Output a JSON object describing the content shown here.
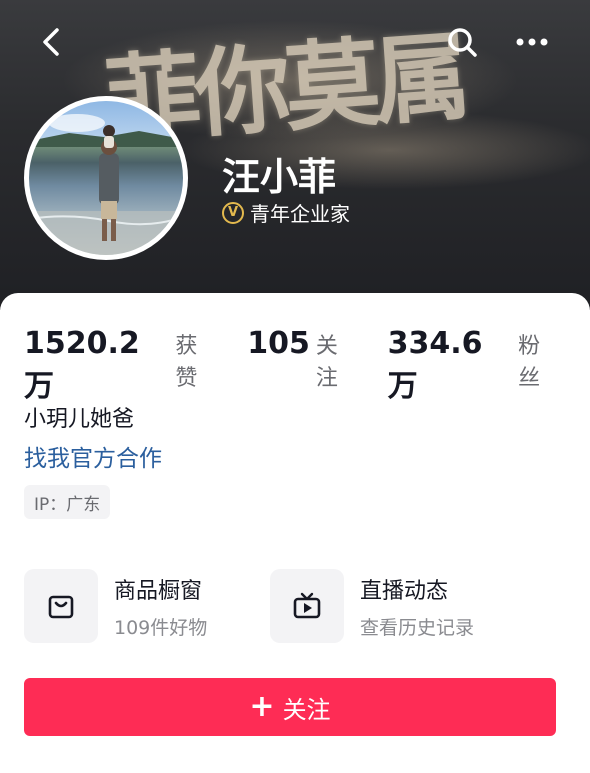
{
  "header": {
    "banner_text": "菲你莫属",
    "icons": {
      "back": "chevron-left-icon",
      "search": "search-icon",
      "more": "more-dots-icon"
    }
  },
  "profile": {
    "name": "汪小菲",
    "badge_icon": "verified-v-icon",
    "badge_letter": "V",
    "badge_text": "青年企业家"
  },
  "stats": [
    {
      "value": "1520.2万",
      "label": "获赞"
    },
    {
      "value": "105",
      "label": "关注"
    },
    {
      "value": "334.6万",
      "label": "粉丝"
    }
  ],
  "bio": "小玥儿她爸",
  "cooperation_link": "找我官方合作",
  "ip_location": "IP：广东",
  "features": [
    {
      "title": "商品橱窗",
      "subtitle": "109件好物",
      "icon": "shopping-bag-icon"
    },
    {
      "title": "直播动态",
      "subtitle": "查看历史记录",
      "icon": "tv-live-icon"
    }
  ],
  "follow_button": {
    "plus": "+",
    "label": "关注"
  },
  "colors": {
    "accent": "#fe2c55",
    "link": "#2b5f9e",
    "badge_gold": "#e3b94e",
    "text_primary": "#161823",
    "text_secondary": "#6a6b70"
  }
}
